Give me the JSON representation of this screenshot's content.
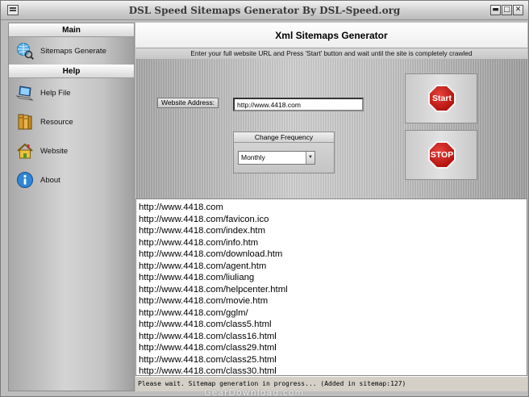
{
  "window": {
    "title": "DSL Speed Sitemaps Generator By DSL-Speed.org",
    "minimize_glyph": "▬",
    "maximize_glyph": "□",
    "close_glyph": "✕"
  },
  "sidebar": {
    "main_header": "Main",
    "main_items": [
      {
        "label": "Sitemaps Generate",
        "icon": "sitemap-globe-icon"
      }
    ],
    "help_header": "Help",
    "help_items": [
      {
        "label": "Help File",
        "icon": "laptop-icon"
      },
      {
        "label": "Resource",
        "icon": "books-icon"
      },
      {
        "label": "Website",
        "icon": "house-icon"
      },
      {
        "label": "About",
        "icon": "info-icon"
      }
    ]
  },
  "main": {
    "title": "Xml Sitemaps Generator",
    "instructions": "Enter your full website URL and Press 'Start' button and wait until the site is completely crawled",
    "website_address_label": "Website Address:",
    "website_address_value": "http://www.4418.com",
    "change_frequency_label": "Change Frequency",
    "frequency_selected": "Monthly",
    "start_button_label": "Start",
    "stop_button_label": "STOP"
  },
  "url_list": [
    "http://www.4418.com",
    "http://www.4418.com/favicon.ico",
    "http://www.4418.com/index.htm",
    "http://www.4418.com/info.htm",
    "http://www.4418.com/download.htm",
    "http://www.4418.com/agent.htm",
    "http://www.4418.com/liuliang",
    "http://www.4418.com/helpcenter.html",
    "http://www.4418.com/movie.htm",
    "http://www.4418.com/gglm/",
    "http://www.4418.com/class5.html",
    "http://www.4418.com/class16.html",
    "http://www.4418.com/class29.html",
    "http://www.4418.com/class25.html",
    "http://www.4418.com/class30.html"
  ],
  "status": "Please wait. Sitemap generation in progress... (Added in sitemap:127)",
  "watermark": "GearDownload.com",
  "colors": {
    "stop_sign_red": "#c4160f"
  }
}
